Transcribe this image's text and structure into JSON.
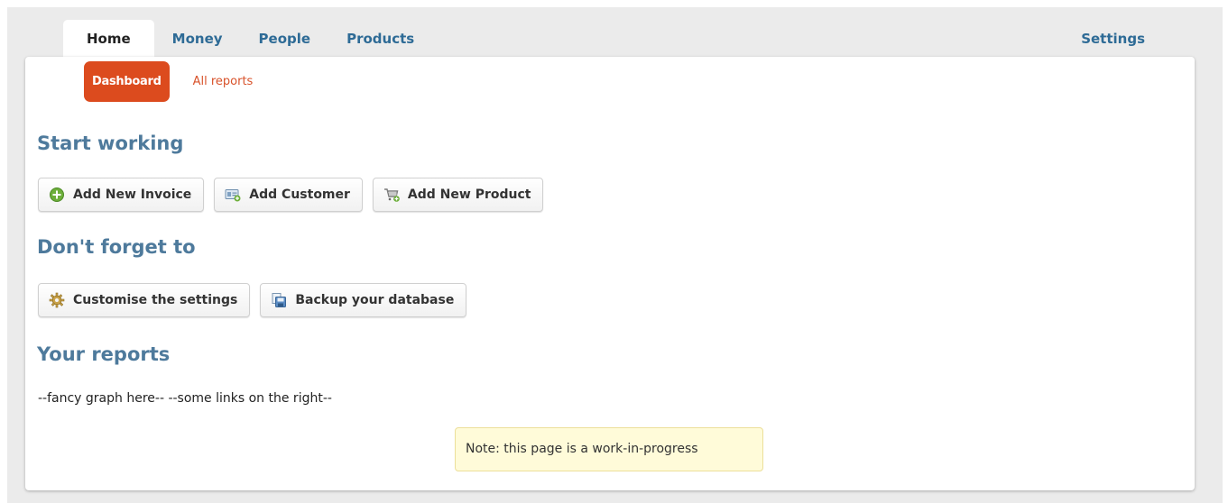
{
  "nav": {
    "tabs": [
      {
        "label": "Home",
        "active": true
      },
      {
        "label": "Money"
      },
      {
        "label": "People"
      },
      {
        "label": "Products"
      }
    ],
    "settings_label": "Settings"
  },
  "subnav": {
    "dashboard_label": "Dashboard",
    "all_reports_label": "All reports"
  },
  "sections": {
    "start_working": {
      "heading": "Start working",
      "buttons": [
        {
          "label": "Add New Invoice",
          "icon": "add-circle-icon"
        },
        {
          "label": "Add Customer",
          "icon": "contact-card-icon"
        },
        {
          "label": "Add New Product",
          "icon": "cart-add-icon"
        }
      ]
    },
    "dont_forget": {
      "heading": "Don't forget to",
      "buttons": [
        {
          "label": "Customise the settings",
          "icon": "gear-icon"
        },
        {
          "label": "Backup your database",
          "icon": "backup-icon"
        }
      ]
    },
    "reports": {
      "heading": "Your reports",
      "placeholder": "--fancy graph here-- --some links on the right--"
    }
  },
  "note": "Note: this page is a work-in-progress",
  "colors": {
    "accent": "#dc4b1e",
    "nav_link": "#2e6b96",
    "heading": "#4e7a9c",
    "note_bg": "#fffbd9"
  }
}
